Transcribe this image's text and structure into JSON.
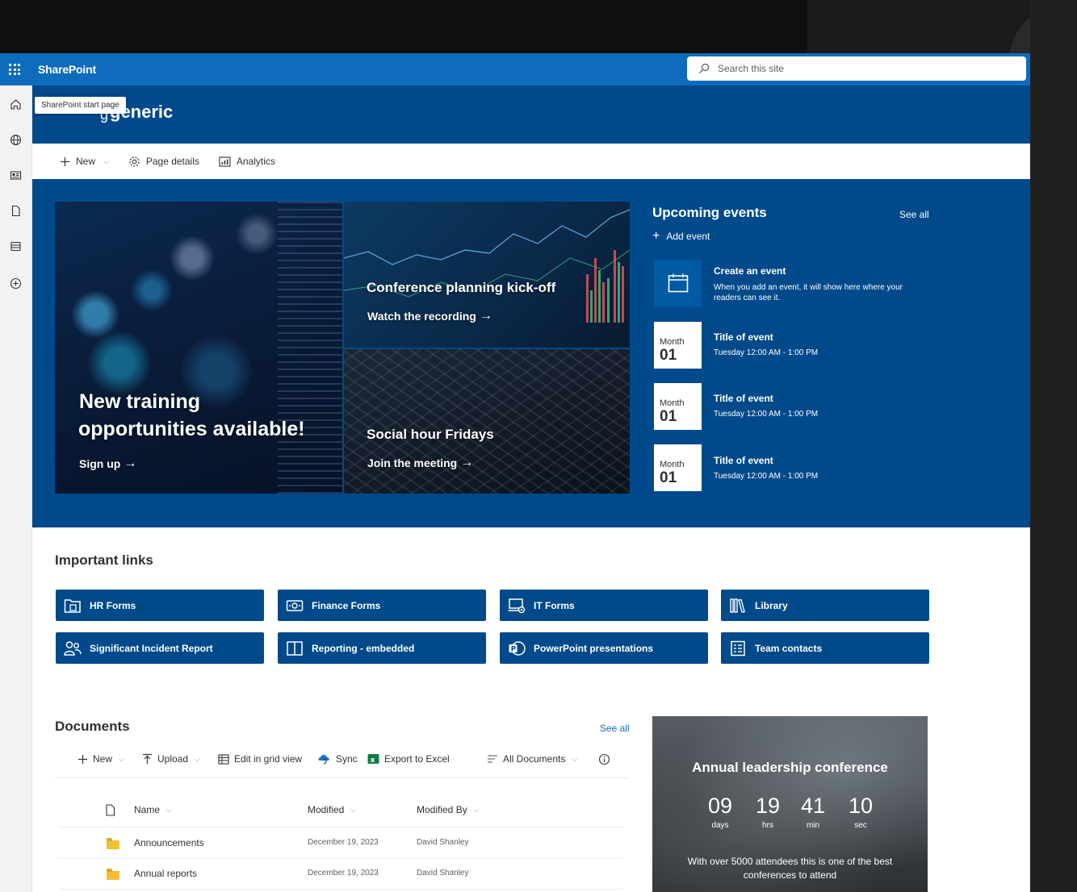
{
  "app": {
    "name": "SharePoint"
  },
  "search": {
    "placeholder": "Search this site"
  },
  "tooltip": "SharePoint start page",
  "site": {
    "title_prefix": "g",
    "title": "generic"
  },
  "commandbar": {
    "new_label": "New",
    "page_details_label": "Page details",
    "analytics_label": "Analytics"
  },
  "hero": {
    "main": {
      "title_line1": "New training",
      "title_line2": "opportunities available!",
      "link": "Sign up"
    },
    "top_right": {
      "title": "Conference planning kick-off",
      "link": "Watch the recording"
    },
    "bottom_right": {
      "title": "Social hour Fridays",
      "link": "Join the meeting"
    }
  },
  "events": {
    "title": "Upcoming events",
    "see_all": "See all",
    "add": "Add event",
    "create": {
      "title": "Create an event",
      "description": "When you add an event, it will show here where your readers can see it."
    },
    "items": [
      {
        "month": "Month",
        "day": "01",
        "title": "Title of event",
        "time": "Tuesday 12:00 AM - 1:00 PM"
      },
      {
        "month": "Month",
        "day": "01",
        "title": "Title of event",
        "time": "Tuesday 12:00 AM - 1:00 PM"
      },
      {
        "month": "Month",
        "day": "01",
        "title": "Title of event",
        "time": "Tuesday 12:00 AM - 1:00 PM"
      }
    ]
  },
  "important_links": {
    "title": "Important links",
    "items": [
      {
        "label": "HR Forms",
        "icon": "form-folder-icon"
      },
      {
        "label": "Finance Forms",
        "icon": "money-icon"
      },
      {
        "label": "IT Forms",
        "icon": "laptop-settings-icon"
      },
      {
        "label": "Library",
        "icon": "library-icon"
      },
      {
        "label": "Significant Incident Report",
        "icon": "people-icon"
      },
      {
        "label": "Reporting - embedded",
        "icon": "columns-icon"
      },
      {
        "label": "PowerPoint presentations",
        "icon": "powerpoint-icon"
      },
      {
        "label": "Team contacts",
        "icon": "contacts-icon"
      }
    ]
  },
  "documents": {
    "title": "Documents",
    "see_all": "See all",
    "commands": {
      "new": "New",
      "upload": "Upload",
      "edit_grid": "Edit in grid view",
      "sync": "Sync",
      "export": "Export to Excel",
      "view": "All Documents"
    },
    "columns": {
      "name": "Name",
      "modified": "Modified",
      "modified_by": "Modified By"
    },
    "rows": [
      {
        "name": "Announcements",
        "modified": "December 19, 2023",
        "modified_by": "David Shanley"
      },
      {
        "name": "Annual reports",
        "modified": "December 19, 2023",
        "modified_by": "David Shanley"
      }
    ]
  },
  "countdown": {
    "title": "Annual leadership conference",
    "days": "09",
    "hours": "19",
    "minutes": "41",
    "seconds": "10",
    "days_label": "days",
    "hours_label": "hrs",
    "minutes_label": "min",
    "seconds_label": "sec",
    "description": "With over 5000 attendees this is one of the best conferences to attend"
  },
  "colors": {
    "suitebar": "#0f6cbd",
    "site_header": "#004a8c",
    "quicklink": "#004a8c",
    "accent_link": "#0f6cbd"
  }
}
